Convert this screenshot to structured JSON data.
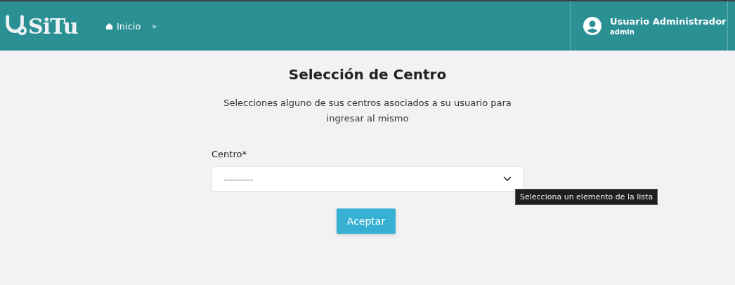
{
  "header": {
    "logo": "SiTu",
    "nav": [
      {
        "label": "Inicio",
        "selected": false
      }
    ],
    "collapse": "»",
    "user": {
      "name": "Usuario Administrador",
      "role": "admin"
    }
  },
  "page": {
    "title": "Selección de Centro",
    "description": "Selecciones alguno de sus centros asociados a su usuario para ingresar al mismo",
    "field": {
      "label": "Centro*",
      "value": "---------"
    },
    "tooltip": "Selecciona un elemento de la lista",
    "button": "Aceptar"
  }
}
